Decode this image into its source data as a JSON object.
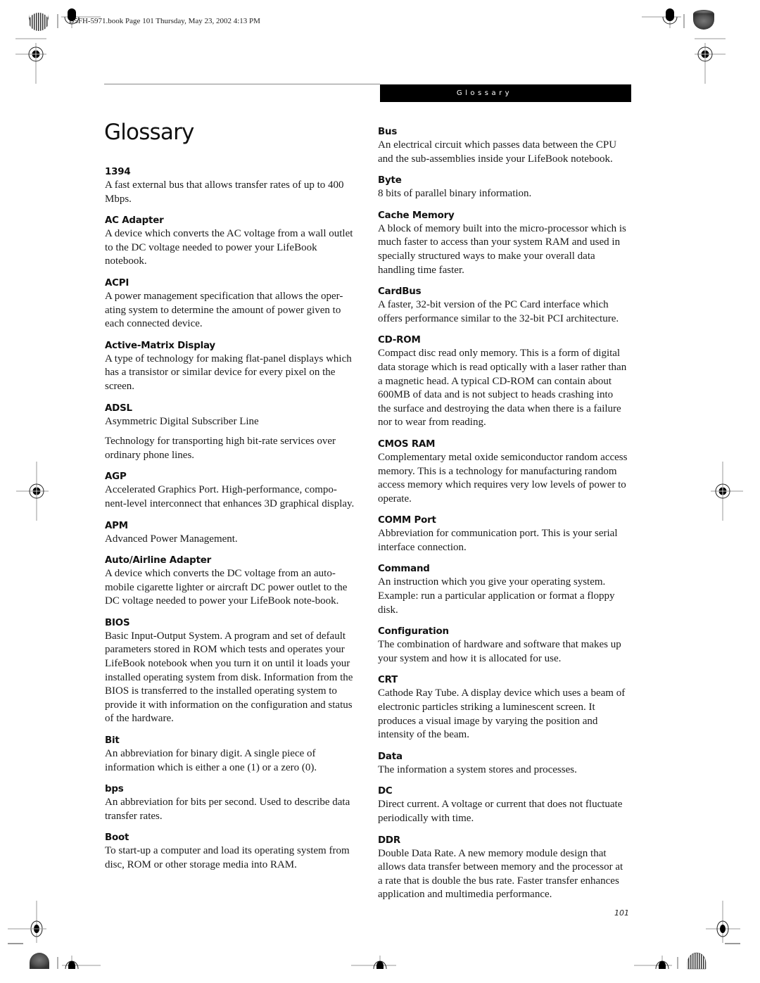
{
  "slug": "B5FH-5971.book  Page 101  Thursday, May 23, 2002  4:13 PM",
  "header_band": "Glossary",
  "page_title": "Glossary",
  "page_number": "101",
  "left_column": [
    {
      "term": "1394",
      "definitions": [
        "A fast external bus that allows transfer rates of up to 400 Mbps."
      ]
    },
    {
      "term": "AC Adapter",
      "definitions": [
        "A device which converts the AC voltage from a wall outlet to the DC voltage needed to power your LifeBook notebook."
      ]
    },
    {
      "term": "ACPI",
      "definitions": [
        "A power management specification that allows the oper-ating system to determine the amount of power given to each connected device."
      ]
    },
    {
      "term": "Active-Matrix Display",
      "definitions": [
        "A type of technology for making flat-panel displays which has a transistor or similar device for every pixel on the screen."
      ]
    },
    {
      "term": "ADSL",
      "definitions": [
        "Asymmetric Digital Subscriber Line",
        "Technology for transporting high bit-rate services over ordinary phone lines."
      ]
    },
    {
      "term": "AGP",
      "definitions": [
        "Accelerated Graphics Port. High-performance, compo-nent-level interconnect that enhances 3D graphical display."
      ]
    },
    {
      "term": "APM",
      "definitions": [
        "Advanced Power Management."
      ]
    },
    {
      "term": "Auto/Airline Adapter",
      "definitions": [
        "A device which converts the DC voltage from an auto-mobile cigarette lighter or aircraft DC power outlet to the DC voltage needed to power your LifeBook note-book."
      ]
    },
    {
      "term": "BIOS",
      "definitions": [
        "Basic Input-Output System. A program and set of default parameters stored in ROM which tests and operates your LifeBook notebook when you turn it on until it loads your installed operating system from disk. Information from the BIOS is transferred to the installed operating system to provide it with information on the configuration and status of the hardware."
      ]
    },
    {
      "term": "Bit",
      "definitions": [
        "An abbreviation for binary digit. A single piece of information which is either a one (1) or a zero (0)."
      ]
    },
    {
      "term": "bps",
      "definitions": [
        "An abbreviation for bits per second. Used to describe data transfer rates."
      ]
    },
    {
      "term": "Boot",
      "definitions": [
        "To start-up a computer and load its operating system from disc, ROM or other storage media into RAM."
      ]
    }
  ],
  "right_column": [
    {
      "term": "Bus",
      "definitions": [
        "An electrical circuit which passes data between the CPU and the sub-assemblies inside your LifeBook notebook."
      ]
    },
    {
      "term": "Byte",
      "definitions": [
        "8 bits of parallel binary information."
      ]
    },
    {
      "term": "Cache Memory",
      "definitions": [
        "A block of memory built into the micro-processor which is much faster to access than your system RAM and used in specially structured ways to make your overall data handling time faster."
      ]
    },
    {
      "term": "CardBus",
      "definitions": [
        "A faster, 32-bit version of the PC Card interface which offers performance similar to the 32-bit PCI architecture."
      ]
    },
    {
      "term": "CD-ROM",
      "definitions": [
        "Compact disc read only memory. This is a form of digital data storage which is read optically with a laser rather than a magnetic head. A typical CD-ROM can contain about 600MB of data and is not subject to heads crashing into the surface and destroying the data when there is a failure nor to wear from reading."
      ]
    },
    {
      "term": "CMOS RAM",
      "definitions": [
        "Complementary metal oxide semiconductor random access memory. This is a technology for manufacturing random access memory which requires very low levels of power to operate."
      ]
    },
    {
      "term": "COMM Port",
      "definitions": [
        "Abbreviation for communication port. This is your serial interface connection."
      ]
    },
    {
      "term": "Command",
      "definitions": [
        "An instruction which you give your operating system. Example: run a particular application or format a floppy disk."
      ]
    },
    {
      "term": "Configuration",
      "definitions": [
        "The combination of hardware and software that makes up your system and how it is allocated for use."
      ]
    },
    {
      "term": "CRT",
      "definitions": [
        "Cathode Ray Tube. A display device which uses a beam of electronic particles striking a luminescent screen. It produces a visual image by varying the position and intensity of the beam."
      ]
    },
    {
      "term": "Data",
      "definitions": [
        "The information a system stores and processes."
      ]
    },
    {
      "term": "DC",
      "definitions": [
        "Direct current. A voltage or current that does not fluctuate periodically with time."
      ]
    },
    {
      "term": "DDR",
      "definitions": [
        "Double Data Rate. A new memory module design that allows data transfer between memory and the processor at a rate that is double the bus rate. Faster transfer enhances application and multimedia performance."
      ]
    }
  ],
  "icons": {
    "registration_mark": "registration-target-icon",
    "color_wheel": "color-calibration-wheel-icon",
    "gray_disc": "gray-calibration-disc-icon"
  }
}
